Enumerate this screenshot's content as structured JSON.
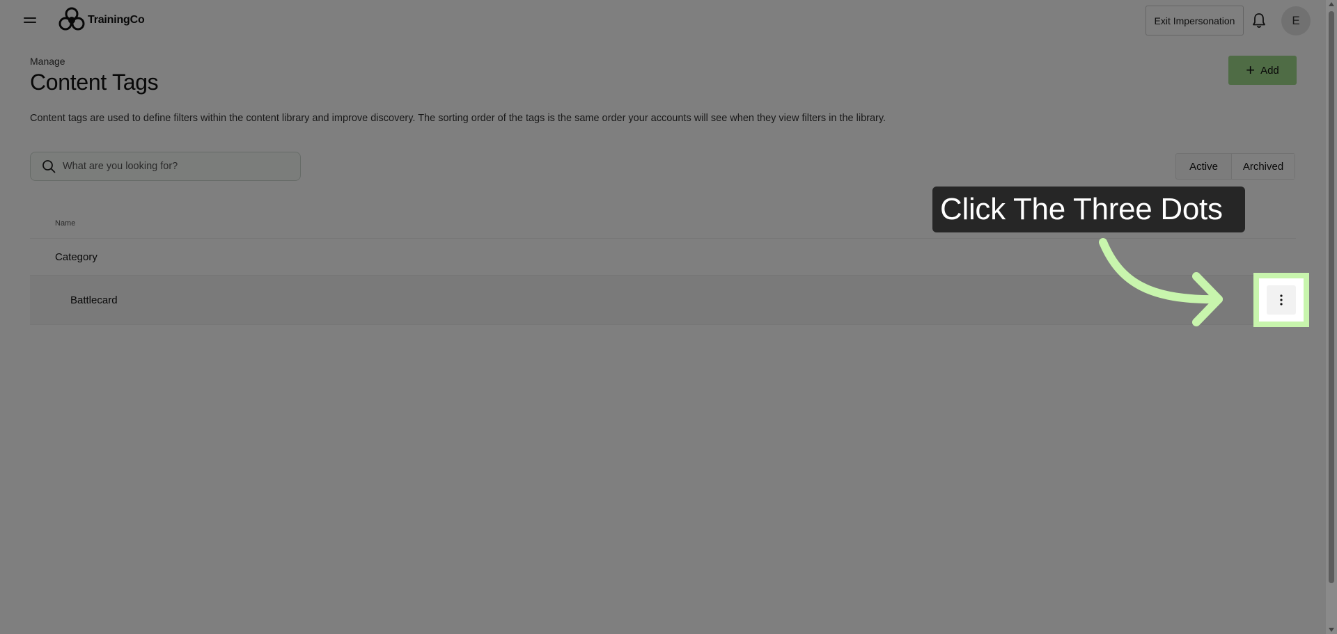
{
  "header": {
    "app_name": "TrainingCo",
    "exit_label": "Exit Impersonation",
    "avatar_initial": "E"
  },
  "page": {
    "eyebrow": "Manage",
    "title": "Content Tags",
    "add_label": "Add",
    "description": "Content tags are used to define filters within the content library and improve discovery. The sorting order of the tags is the same order your accounts will see when they view filters in the library."
  },
  "search": {
    "placeholder": "What are you looking for?"
  },
  "status_filter": {
    "options": [
      "Active",
      "Archived"
    ]
  },
  "table": {
    "column_name": "Name",
    "category": "Category",
    "rows": [
      {
        "name": "Battlecard"
      }
    ]
  },
  "callout": {
    "text": "Click The Three Dots",
    "accent_color": "#c8f5ad"
  },
  "icons": {
    "menu": "hamburger-icon",
    "logo": "trainingco-logo-icon",
    "notifications": "bell-icon",
    "search": "search-icon",
    "add": "plus-icon",
    "row_actions": "vertical-ellipsis-icon",
    "pointer": "curved-arrow-icon"
  }
}
